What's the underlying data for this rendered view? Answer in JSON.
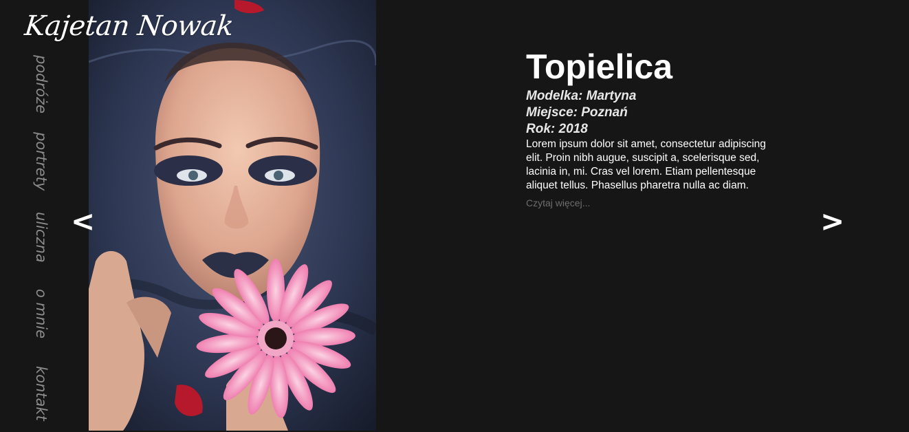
{
  "brand": {
    "logo_text": "Kajetan Nowak"
  },
  "nav": {
    "items": [
      {
        "label": "podróże"
      },
      {
        "label": "portrety"
      },
      {
        "label": "uliczna"
      },
      {
        "label": "o mnie"
      },
      {
        "label": "kontakt"
      }
    ]
  },
  "slider": {
    "prev_label": "<",
    "next_label": ">",
    "photo_icon": "portrait-photo"
  },
  "post": {
    "title": "Topielica",
    "model": "Modelka: Martyna",
    "place": "Miejsce: Poznań",
    "year": "Rok: 2018",
    "description": "Lorem ipsum dolor sit amet, consectetur adipiscing elit. Proin nibh augue, suscipit a, scelerisque sed, lacinia in, mi. Cras vel lorem. Etiam pellentesque aliquet tellus. Phasellus pharetra nulla ac diam.",
    "read_more": "Czytaj więcej..."
  },
  "colors": {
    "background": "#161616",
    "text": "#ffffff",
    "nav_text": "#8c8c8c",
    "muted_link": "#6d6d6d"
  }
}
